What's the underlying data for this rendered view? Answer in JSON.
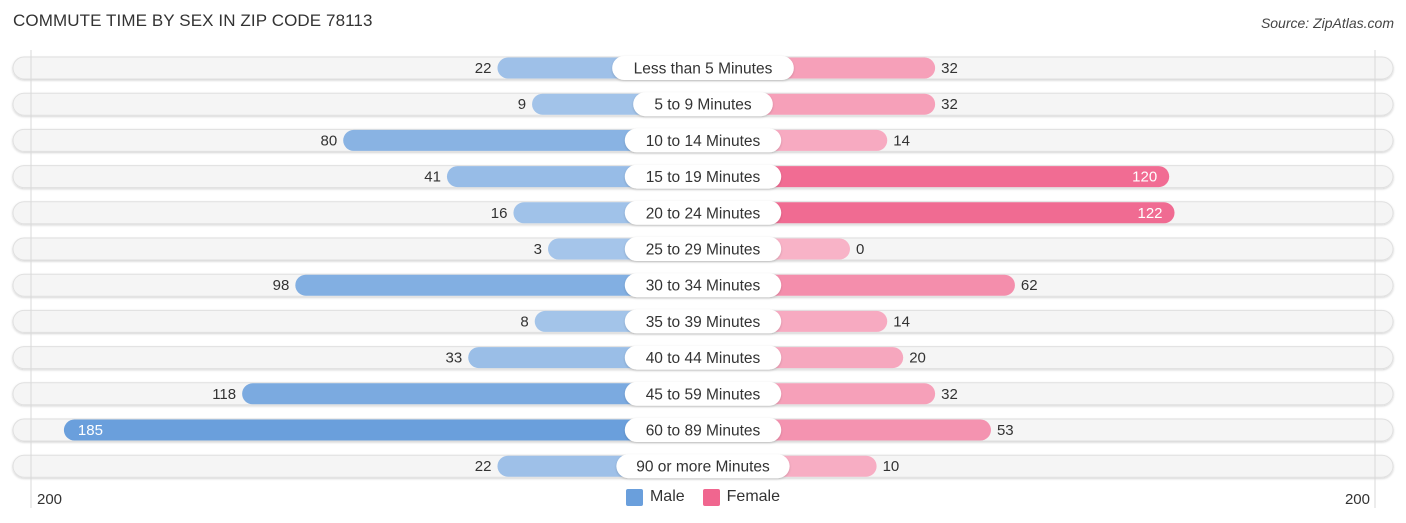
{
  "chart_data": {
    "type": "bar",
    "orientation": "horizontal-diverging",
    "title": "COMMUTE TIME BY SEX IN ZIP CODE 78113",
    "source": "Source: ZipAtlas.com",
    "categories": [
      "Less than 5 Minutes",
      "5 to 9 Minutes",
      "10 to 14 Minutes",
      "15 to 19 Minutes",
      "20 to 24 Minutes",
      "25 to 29 Minutes",
      "30 to 34 Minutes",
      "35 to 39 Minutes",
      "40 to 44 Minutes",
      "45 to 59 Minutes",
      "60 to 89 Minutes",
      "90 or more Minutes"
    ],
    "series": [
      {
        "name": "Male",
        "color": "#6a9fdc",
        "values": [
          22,
          9,
          80,
          41,
          16,
          3,
          98,
          8,
          33,
          118,
          185,
          22
        ]
      },
      {
        "name": "Female",
        "color": "#f0668f",
        "values": [
          32,
          32,
          14,
          120,
          122,
          0,
          62,
          14,
          20,
          32,
          53,
          10
        ]
      }
    ],
    "axis": {
      "left_label": "200",
      "right_label": "200",
      "max": 200
    },
    "legend": {
      "position": "bottom-center",
      "items": [
        {
          "label": "Male",
          "color": "#6a9fdc"
        },
        {
          "label": "Female",
          "color": "#f0668f"
        }
      ]
    }
  }
}
